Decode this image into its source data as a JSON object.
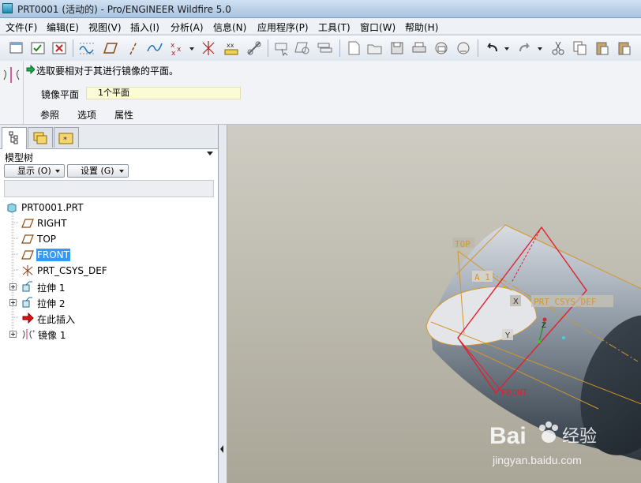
{
  "window": {
    "title": "PRT0001 (活动的) - Pro/ENGINEER Wildfire 5.0"
  },
  "menubar": {
    "items": [
      "文件(F)",
      "编辑(E)",
      "视图(V)",
      "插入(I)",
      "分析(A)",
      "信息(N)",
      "应用程序(P)",
      "工具(T)",
      "窗口(W)",
      "帮助(H)"
    ]
  },
  "dashboard": {
    "prompt": "选取要相对于其进行镜像的平面。",
    "mirror_plane_label": "镜像平面",
    "mirror_plane_value": "1个平面",
    "tabs": [
      "参照",
      "选项",
      "属性"
    ]
  },
  "model_tree": {
    "title": "模型树",
    "show_button": "显示 (O)",
    "settings_button": "设置 (G)",
    "items": [
      {
        "label": "PRT0001.PRT",
        "icon": "part-icon"
      },
      {
        "label": "RIGHT",
        "icon": "datum-plane-icon"
      },
      {
        "label": "TOP",
        "icon": "datum-plane-icon"
      },
      {
        "label": "FRONT",
        "icon": "datum-plane-icon",
        "selected": true
      },
      {
        "label": "PRT_CSYS_DEF",
        "icon": "coordinate-system-icon"
      },
      {
        "label": "拉伸 1",
        "icon": "extrude-icon"
      },
      {
        "label": "拉伸 2",
        "icon": "extrude-icon"
      },
      {
        "label": "在此插入",
        "icon": "insert-here-arrow-icon"
      },
      {
        "label": "镜像 1",
        "icon": "mirror-feature-icon"
      }
    ]
  },
  "viewport": {
    "labels": {
      "top": "TOP",
      "axis": "A_1",
      "csys": "PRT_CSYS_DEF",
      "front": "FRONT",
      "x": "X",
      "y": "Y",
      "z": "Z"
    }
  },
  "watermark": {
    "brand": "Bai",
    "brand2": "经验",
    "url": "jingyan.baidu.com"
  },
  "colors": {
    "selection": "#3399ff",
    "datum": "#d4962a",
    "highlight": "#e02030",
    "viewport_bg": "#bdbbb0"
  }
}
